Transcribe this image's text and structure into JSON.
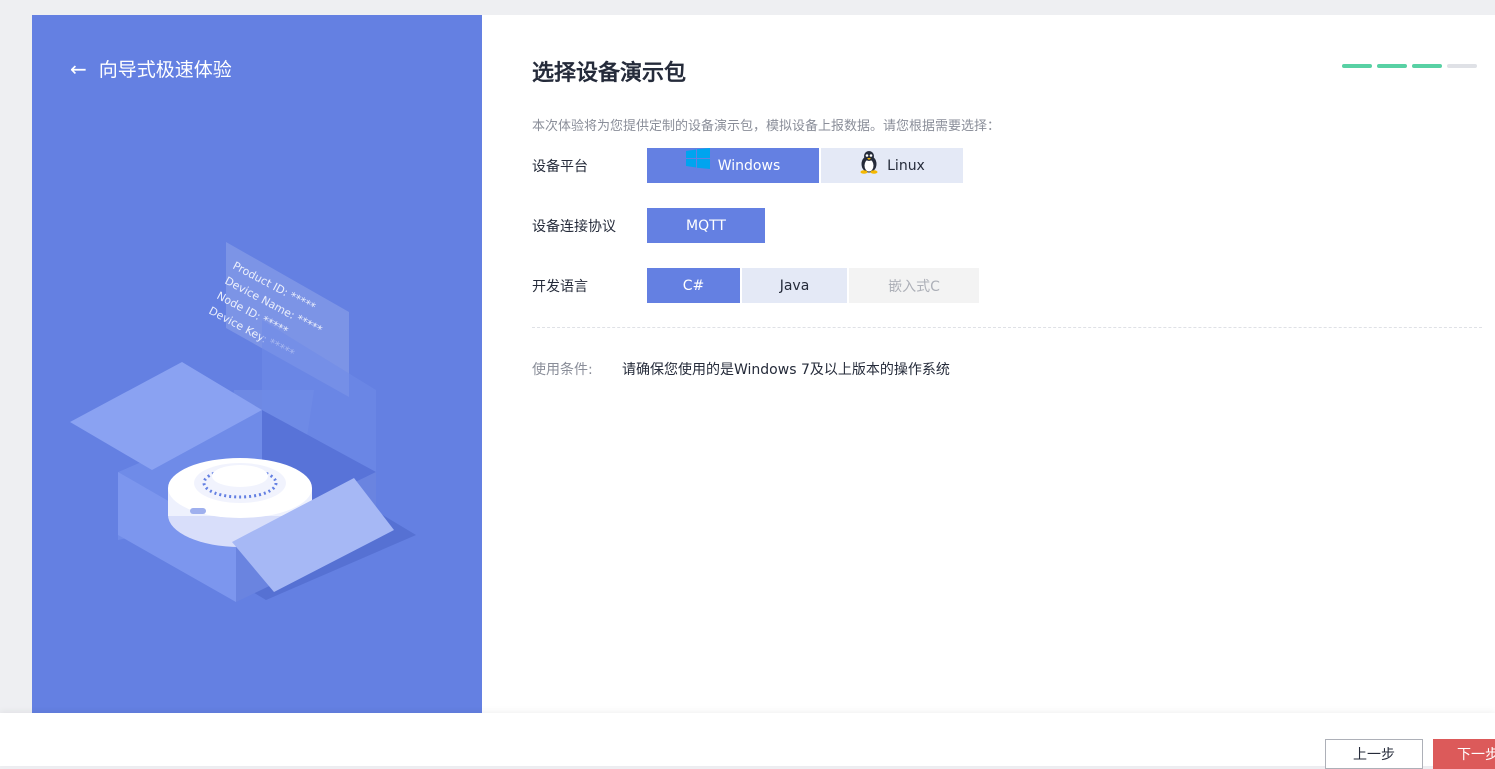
{
  "header": {
    "back_label": "向导式极速体验"
  },
  "illustration_text": [
    "Product ID: *****",
    "Device Name: *****",
    "Node ID: *****",
    "Device Key: *****"
  ],
  "main": {
    "title": "选择设备演示包",
    "progress_steps": {
      "total": 4,
      "completed": 3
    },
    "description": "本次体验将为您提供定制的设备演示包，模拟设备上报数据。请您根据需要选择：",
    "platform": {
      "label": "设备平台",
      "options": [
        {
          "label": "Windows",
          "icon": "windows-icon",
          "state": "selected"
        },
        {
          "label": "Linux",
          "icon": "linux-tux-icon",
          "state": "normal"
        }
      ]
    },
    "protocol": {
      "label": "设备连接协议",
      "options": [
        {
          "label": "MQTT",
          "state": "selected"
        }
      ]
    },
    "language": {
      "label": "开发语言",
      "options": [
        {
          "label": "C#",
          "state": "selected"
        },
        {
          "label": "Java",
          "state": "normal"
        },
        {
          "label": "嵌入式C",
          "state": "disabled"
        }
      ]
    },
    "condition": {
      "label": "使用条件:",
      "value": "请确保您使用的是Windows 7及以上版本的操作系统"
    }
  },
  "footer": {
    "prev_label": "上一步",
    "next_label": "下一步"
  },
  "colors": {
    "brand": "#6480e2",
    "step_done": "#58d1a4",
    "step_todo": "#dfe1e6",
    "option_bg": "#e4e9f6",
    "next_button": "#dc5a5a",
    "windows_logo": "#00a4ef"
  }
}
